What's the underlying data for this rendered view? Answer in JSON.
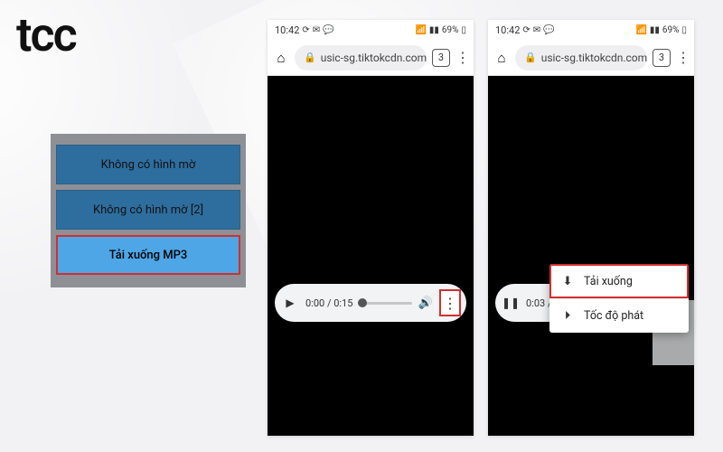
{
  "logo": "tcc",
  "panel": {
    "btn1": "Không có hình mờ",
    "btn2": "Không có hình mờ [2]",
    "btn3": "Tải xuống MP3"
  },
  "status": {
    "time": "10:42",
    "battery": "69%"
  },
  "browser": {
    "url": "usic-sg.tiktokcdn.com",
    "tabs": "3"
  },
  "playerA": {
    "time": "0:00 / 0:15"
  },
  "playerB": {
    "time": "0:03 /"
  },
  "popup": {
    "download": "Tải xuống",
    "speed": "Tốc độ phát"
  }
}
